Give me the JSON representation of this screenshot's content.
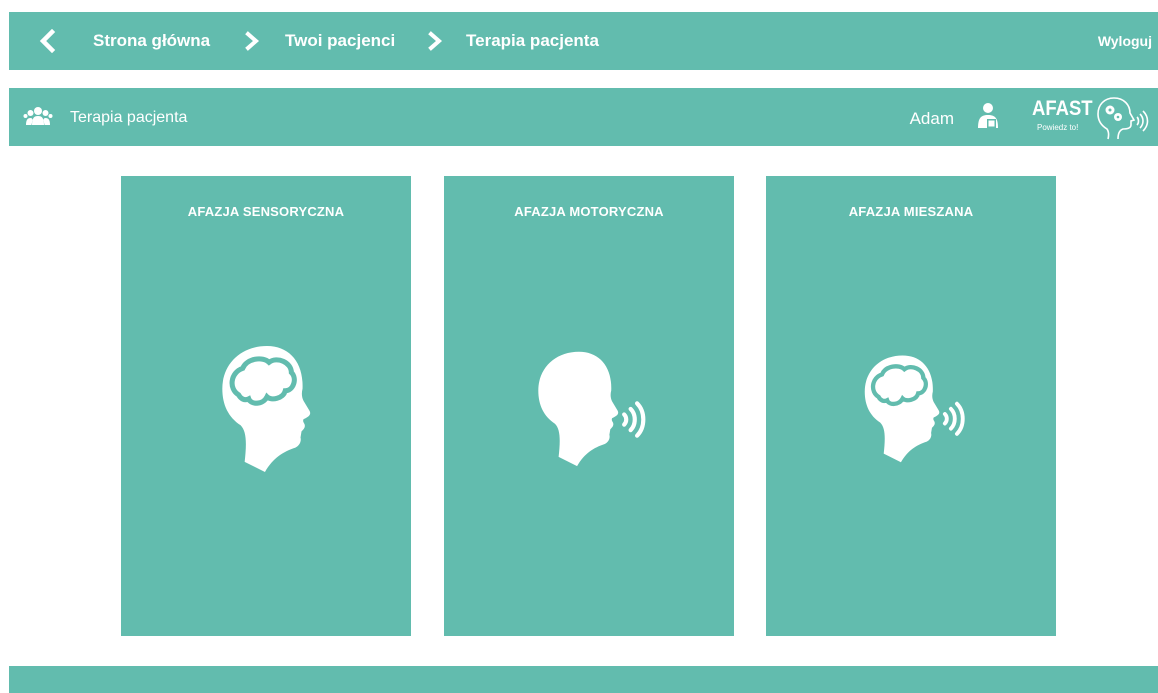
{
  "nav": {
    "breadcrumbs": [
      {
        "label": "Strona główna"
      },
      {
        "label": "Twoi pacjenci"
      },
      {
        "label": "Terapia pacjenta"
      }
    ],
    "logout_label": "Wyloguj"
  },
  "subheader": {
    "title": "Terapia pacjenta",
    "user_name": "Adam",
    "logo_title": "AFAST",
    "logo_subtitle": "Powiedz to!"
  },
  "cards": [
    {
      "title": "AFAZJA SENSORYCZNA",
      "icon": "head-brain-icon"
    },
    {
      "title": "AFAZJA MOTORYCZNA",
      "icon": "head-speaking-icon"
    },
    {
      "title": "AFAZJA MIESZANA",
      "icon": "head-brain-speaking-icon"
    }
  ],
  "colors": {
    "accent": "#62bcae",
    "background": "#ffffff",
    "text": "#ffffff"
  }
}
